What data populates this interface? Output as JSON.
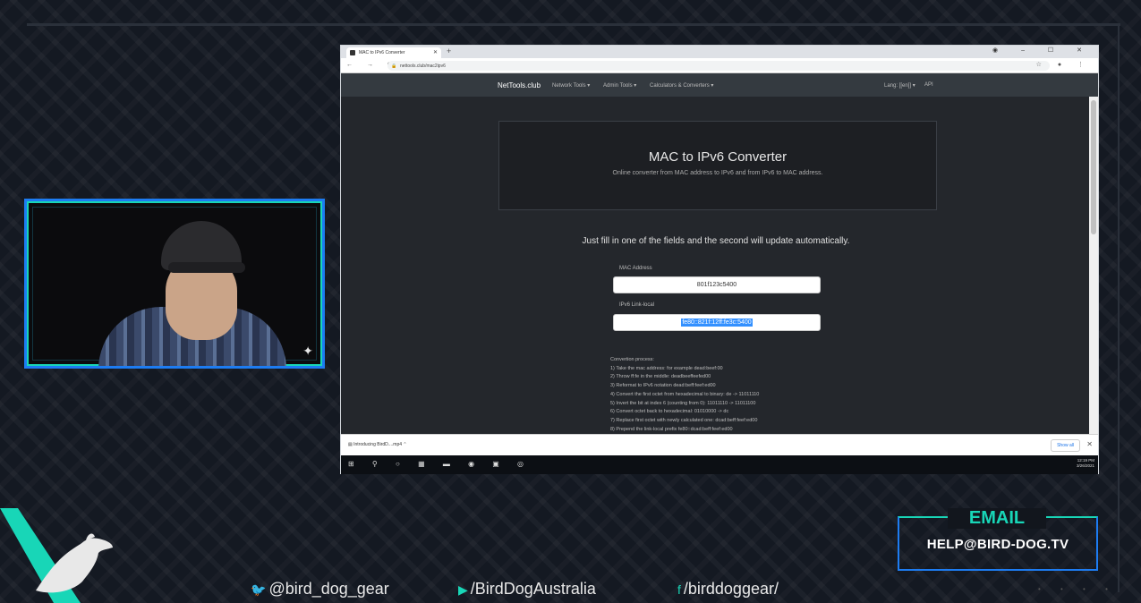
{
  "browser": {
    "tab_title": "MAC to IPv6 Converter",
    "url": "nettools.club/mac2ipv6"
  },
  "site": {
    "brand": "NetTools.club",
    "nav": [
      "Network Tools ▾",
      "Admin Tools ▾",
      "Calculators & Converters ▾"
    ],
    "nav_right": [
      "Lang: [[en]] ▾",
      "API"
    ]
  },
  "page": {
    "title": "MAC to IPv6 Converter",
    "subtitle": "Online converter from MAC address to IPv6 and from IPv6 to MAC address.",
    "lead": "Just fill in one of the fields and the second will update automatically.",
    "mac_label": "MAC Address",
    "mac_value": "801f123c5400",
    "ipv6_label": "IPv6 Link-local",
    "ipv6_value": "fe80::821f:12ff:fe3c:5400",
    "process_title": "Convertion process:",
    "process_steps": [
      "1) Take the mac address: for example dead:beef:00",
      "2) Throw ff:fe in the middle: deadbeeffeefed00",
      "3) Reformat to IPv6 notation dead:beff:feef:ed00",
      "4) Convert the first octet from hexadecimal to binary: de -> 11011110",
      "5) Invert the bit at index 6 (counting from 0): 11011110 -> 11011100",
      "6) Convert octet back to hexadecimal: 01010000 -> dc",
      "7) Replace first octet with newly calculated one: dcad:beff:feef:ed00",
      "8) Prepend the link-local prefix fe80::dcad:beff:feef:ed00"
    ]
  },
  "downloads": {
    "item": "Introducing BirdD....mp4",
    "show_all": "Show all"
  },
  "taskbar": {
    "time": "12:19 PM",
    "date": "3/26/2021"
  },
  "overlay": {
    "email_title": "EMAIL",
    "email_address": "HELP@BIRD-DOG.TV",
    "twitter": "@bird_dog_gear",
    "youtube": "/BirdDogAustralia",
    "facebook": "/birddoggear/"
  },
  "colors": {
    "accent_teal": "#18d6b7",
    "accent_blue": "#1d7cf2"
  }
}
